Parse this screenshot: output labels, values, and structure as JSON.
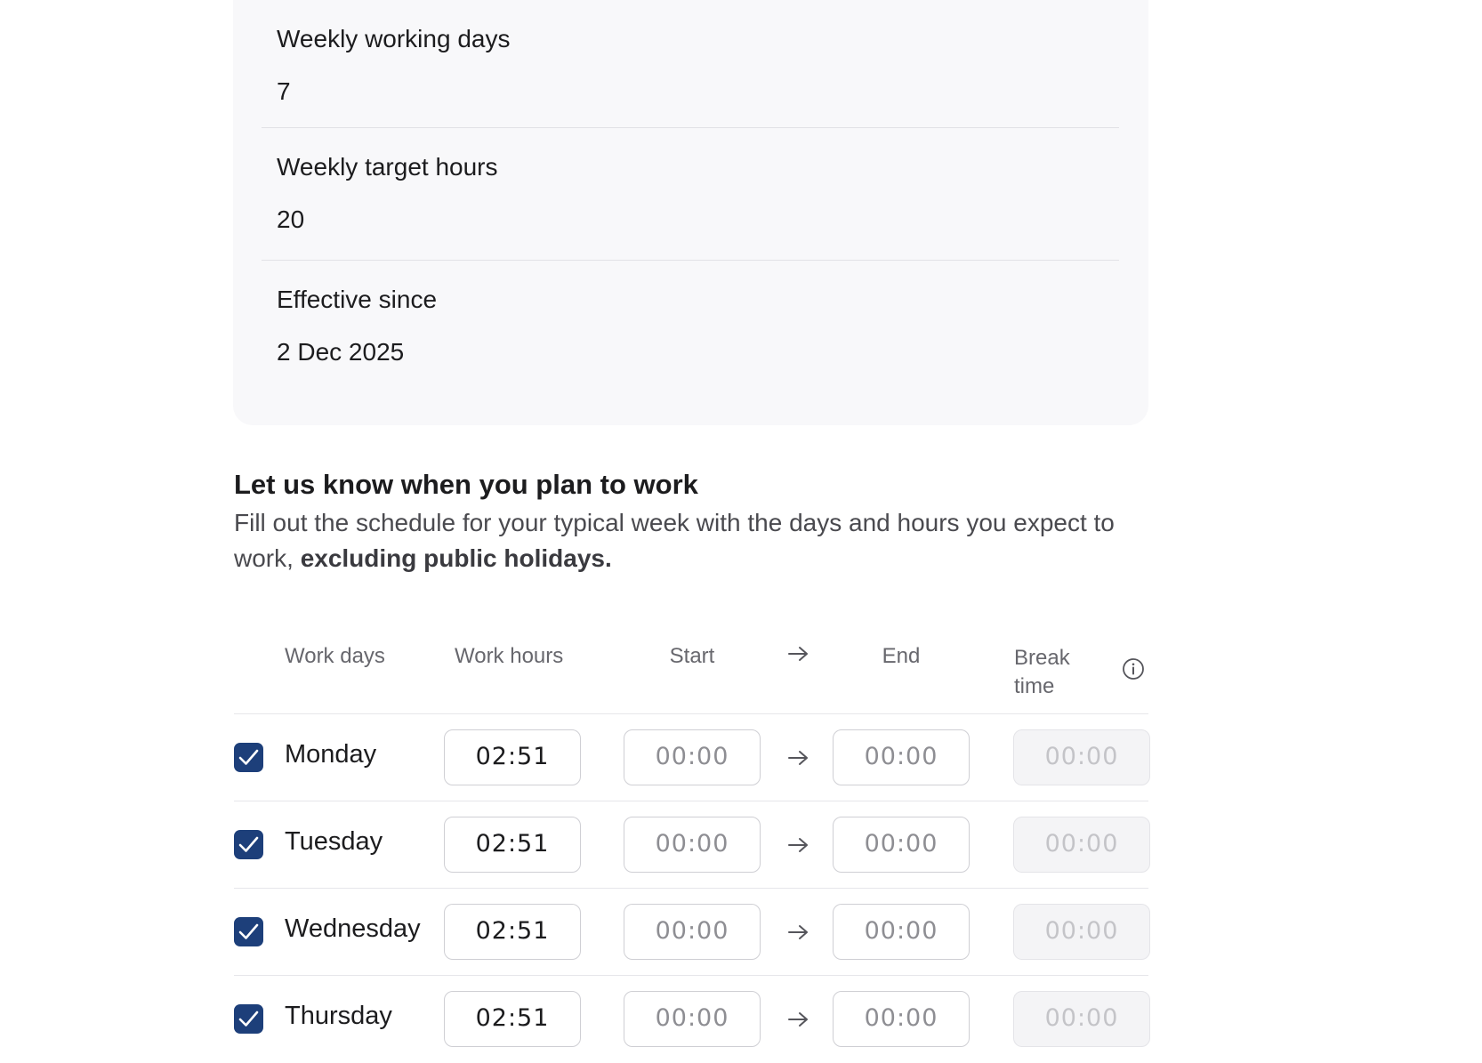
{
  "summary": {
    "items": [
      {
        "label": "Weekly working days",
        "value": "7"
      },
      {
        "label": "Weekly target hours",
        "value": "20"
      },
      {
        "label": "Effective since",
        "value": "2 Dec 2025"
      }
    ]
  },
  "schedule": {
    "title": "Let us know when you plan to work",
    "description_lead": "Fill out the schedule for your typical week with the days and hours you expect to work, ",
    "description_bold": "excluding public holidays."
  },
  "table": {
    "headers": {
      "work_days": "Work days",
      "work_hours": "Work hours",
      "start": "Start",
      "end": "End",
      "break_line1": "Break",
      "break_line2": "time"
    },
    "rows": [
      {
        "day": "Monday",
        "checked": true,
        "work_hours": "02:51",
        "start": "00:00",
        "end": "00:00",
        "break": "00:00"
      },
      {
        "day": "Tuesday",
        "checked": true,
        "work_hours": "02:51",
        "start": "00:00",
        "end": "00:00",
        "break": "00:00"
      },
      {
        "day": "Wednesday",
        "checked": true,
        "work_hours": "02:51",
        "start": "00:00",
        "end": "00:00",
        "break": "00:00"
      },
      {
        "day": "Thursday",
        "checked": true,
        "work_hours": "02:51",
        "start": "00:00",
        "end": "00:00",
        "break": "00:00"
      }
    ]
  },
  "icons": {
    "arrow": "arrow-right-icon",
    "info": "info-icon",
    "check": "checkmark-icon"
  },
  "colors": {
    "checkbox": "#1d3f7a",
    "card_background": "#f8f8fa",
    "disabled_field": "#f4f4f6"
  }
}
